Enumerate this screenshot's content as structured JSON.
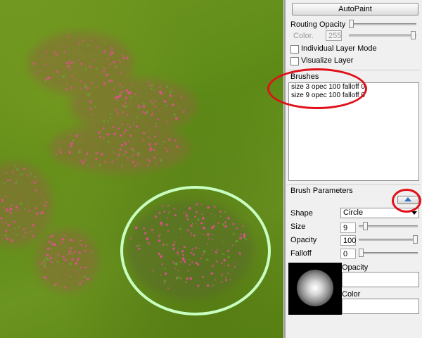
{
  "panel": {
    "autopaint_label": "AutoPaint",
    "routing_opacity_label": "Routing Opacity",
    "color_label": "Color.",
    "color_value": "255",
    "individual_layer_label": "Individual Layer Mode",
    "visualize_layer_label": "Visualize Layer",
    "brushes_title": "Brushes",
    "brushes": [
      "size 3  opec 100  falloff 0",
      "size 9  opec 100  falloff 0"
    ],
    "brush_params_title": "Brush Parameters",
    "shape_label": "Shape",
    "shape_value": "Circle",
    "size_label": "Size",
    "size_value": "9",
    "opacity_label": "Opacity",
    "opacity_value": "100",
    "falloff_label": "Falloff",
    "falloff_value": "0",
    "preview_opacity_label": "Opacity",
    "preview_color_label": "Color"
  },
  "colors": {
    "annotation_red": "#e0101a",
    "brush_cursor": "#c8ffc0",
    "flower_pink": "#e0508f"
  },
  "icons": {
    "collapse": "chevron-up-icon",
    "dropdown": "chevron-down-icon"
  }
}
